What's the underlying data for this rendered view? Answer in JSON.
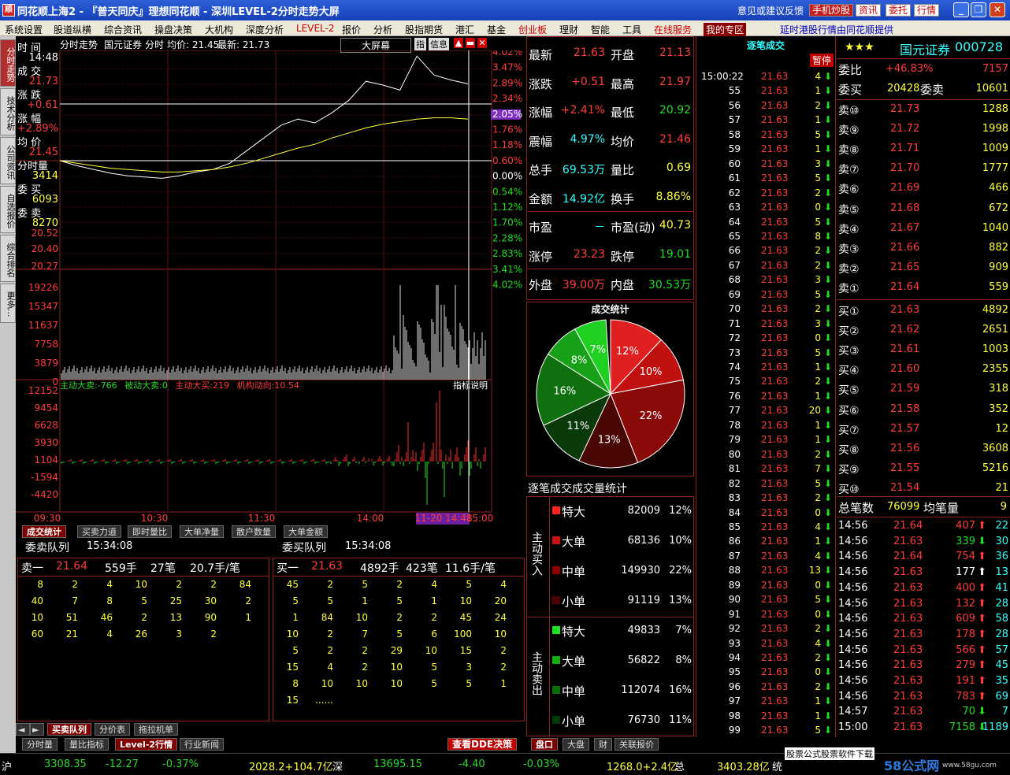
{
  "title": "同花顺上海2 - 『普天同庆』理想同花顺 - 深圳LEVEL-2分时走势大屏",
  "titlebar": {
    "feedback": "意见或建议反馈",
    "mobile": "手机炒股",
    "info": "资讯",
    "commission": "委托",
    "quote": "行情"
  },
  "menu": [
    "系统设置",
    "股道纵横",
    "综合资讯",
    "操盘决策",
    "大机构",
    "深度分析",
    "LEVEL-2",
    "报价",
    "分析",
    "股指期货",
    "港汇",
    "基金",
    "创业板",
    "理财",
    "智能",
    "工具",
    "在线服务",
    "我的专区",
    "延时港股行情由同花顺提供"
  ],
  "sidebar": [
    "分时走势",
    "技术分析",
    "公司资讯",
    "自选报价",
    "综合排名",
    "更多..."
  ],
  "left_info": {
    "time_lbl": "时 间",
    "time_val": "14:48",
    "trade_lbl": "成 交",
    "trade_val": "21.73",
    "chg_lbl": "涨 跌",
    "chg_val": "+0.61",
    "pct_lbl": "涨 幅",
    "pct_val": "+2.89%",
    "avg_lbl": "均 价",
    "avg_val": "21.45",
    "vol_lbl": "分时量",
    "vol_val": "3414",
    "bid_lbl": "委 买",
    "bid_val": "6093",
    "ask_lbl": "委 卖",
    "ask_val": "8270"
  },
  "chart_header": {
    "title": "分时走势",
    "broker": "国元证券",
    "mode": "分时",
    "avg": "均价: 21.45",
    "last": "最新: 21.73",
    "bigscreen": "大屏幕",
    "btn_fit": "指",
    "btn_info": "信息"
  },
  "chart_data": {
    "type": "line",
    "price_axis_left": [
      "20.52",
      "20.40",
      "20.27"
    ],
    "pct_axis_right": [
      "4.02%",
      "3.47%",
      "2.89%",
      "2.34%",
      "2.05%",
      "1.76%",
      "1.18%",
      "0.60%",
      "0.00%",
      "0.54%",
      "1.12%",
      "1.70%",
      "2.28%",
      "2.83%",
      "3.41%",
      "4.02%"
    ],
    "volume_axis": [
      "19226",
      "15347",
      "11637",
      "7758",
      "3879",
      "0"
    ],
    "flow_axis": [
      "12152",
      "9454",
      "6628",
      "3930",
      "1104",
      "-1594",
      "-4420"
    ],
    "time_axis": [
      "09:30",
      "10:30",
      "11:30",
      "14:00",
      "11-20 14:48",
      "15:00"
    ],
    "price": [
      21.12,
      21.08,
      21.05,
      21.02,
      21.0,
      20.99,
      20.98,
      21.0,
      21.03,
      21.05,
      21.1,
      21.2,
      21.3,
      21.4,
      21.45,
      21.42,
      21.5,
      21.6,
      21.75,
      21.72,
      21.68,
      21.95,
      21.8,
      21.76,
      21.73
    ],
    "avg_line": [
      21.12,
      21.1,
      21.08,
      21.06,
      21.05,
      21.04,
      21.03,
      21.03,
      21.04,
      21.05,
      21.07,
      21.1,
      21.14,
      21.18,
      21.22,
      21.25,
      21.3,
      21.34,
      21.38,
      21.41,
      21.43,
      21.45,
      21.46,
      21.46,
      21.45
    ]
  },
  "flow_legend": {
    "a": "主动大卖:",
    "a_val": "-766",
    "b": "被动大卖:",
    "b_val": "0",
    "c": "主动大买:",
    "c_val": "219",
    "d": "机构动向:",
    "d_val": "10.54",
    "explain": "指标说明"
  },
  "tabs_mid": [
    "成交统计",
    "买卖力道",
    "即时量比",
    "大单净量",
    "散户数量",
    "大单金额"
  ],
  "queue": {
    "sell_title": "委卖队列",
    "sell_time": "15:34:08",
    "buy_title": "委买队列",
    "buy_time": "15:34:08",
    "sell_head": [
      "卖一",
      "21.64",
      "559手",
      "27笔",
      "20.7手/笔"
    ],
    "buy_head": [
      "买一",
      "21.63",
      "4892手",
      "423笔",
      "11.6手/笔"
    ],
    "sell_rows": [
      [
        "8",
        "2",
        "4",
        "10",
        "2",
        "2",
        "84"
      ],
      [
        "40",
        "7",
        "8",
        "5",
        "25",
        "30",
        "2"
      ],
      [
        "10",
        "51",
        "46",
        "2",
        "13",
        "90",
        "1"
      ],
      [
        "60",
        "21",
        "4",
        "26",
        "3",
        "2",
        ""
      ]
    ],
    "buy_rows": [
      [
        "45",
        "2",
        "5",
        "2",
        "4",
        "5",
        "4"
      ],
      [
        "5",
        "5",
        "1",
        "5",
        "1",
        "10",
        "20"
      ],
      [
        "1",
        "84",
        "10",
        "2",
        "2",
        "45",
        "24"
      ],
      [
        "10",
        "2",
        "7",
        "5",
        "6",
        "100",
        "10"
      ],
      [
        "5",
        "2",
        "2",
        "29",
        "10",
        "15",
        "2"
      ],
      [
        "15",
        "4",
        "2",
        "10",
        "5",
        "3",
        "2"
      ],
      [
        "8",
        "10",
        "10",
        "10",
        "5",
        "5",
        "1"
      ],
      [
        "15",
        "......",
        "",
        "",
        "",
        "",
        ""
      ]
    ]
  },
  "bottom_tabs1": [
    "买卖队列",
    "分价表",
    "拖拉机单"
  ],
  "bottom_tabs2": [
    "分时量",
    "量比指标",
    "Level-2行情",
    "行业新闻"
  ],
  "ddebtn": "查看DDE决策",
  "bottom_tabs3": [
    "盘口",
    "大盘",
    "财",
    "关联报价"
  ],
  "quote": [
    {
      "l": "最新",
      "v": "21.63",
      "l2": "开盘",
      "v2": "21.13"
    },
    {
      "l": "涨跌",
      "v": "+0.51",
      "l2": "最高",
      "v2": "21.97"
    },
    {
      "l": "涨幅",
      "v": "+2.41%",
      "l2": "最低",
      "v2": "20.92"
    },
    {
      "l": "震幅",
      "v": "4.97%",
      "l2": "均价",
      "v2": "21.46"
    },
    {
      "l": "总手",
      "v": "69.53万",
      "l2": "量比",
      "v2": "0.69"
    },
    {
      "l": "金额",
      "v": "14.92亿",
      "l2": "换手",
      "v2": "8.86%"
    },
    {
      "l": "市盈",
      "v": "－",
      "l2": "市盈(动)",
      "v2": "40.73"
    },
    {
      "l": "涨停",
      "v": "23.23",
      "l2": "跌停",
      "v2": "19.01"
    },
    {
      "l": "外盘",
      "v": "39.00万",
      "l2": "内盘",
      "v2": "30.53万"
    }
  ],
  "pie": {
    "title": "成交统计",
    "slices": [
      {
        "pct": 12,
        "color": "#e02020"
      },
      {
        "pct": 10,
        "color": "#c01010"
      },
      {
        "pct": 22,
        "color": "#8a0a0a"
      },
      {
        "pct": 13,
        "color": "#4a0505"
      },
      {
        "pct": 11,
        "color": "#0a3a0a"
      },
      {
        "pct": 16,
        "color": "#107010"
      },
      {
        "pct": 8,
        "color": "#18a018"
      },
      {
        "pct": 7,
        "color": "#20d020"
      }
    ]
  },
  "vol_stats": {
    "title": "逐笔成交成交量统计",
    "buy_lbl": "主动买入",
    "sell_lbl": "主动卖出",
    "buy": [
      {
        "n": "特大",
        "v": "82009",
        "p": "12%"
      },
      {
        "n": "大单",
        "v": "68136",
        "p": "10%"
      },
      {
        "n": "中单",
        "v": "149930",
        "p": "22%"
      },
      {
        "n": "小单",
        "v": "91119",
        "p": "13%"
      }
    ],
    "sell": [
      {
        "n": "特大",
        "v": "49833",
        "p": "7%"
      },
      {
        "n": "大单",
        "v": "56822",
        "p": "8%"
      },
      {
        "n": "中单",
        "v": "112074",
        "p": "16%"
      },
      {
        "n": "小单",
        "v": "76730",
        "p": "11%"
      }
    ]
  },
  "ticks": {
    "title": "逐笔成交",
    "pause": "暂停",
    "first_time": "15:00:22",
    "rows": [
      [
        "",
        21.63,
        4
      ],
      [
        "55",
        21.63,
        1
      ],
      [
        "56",
        21.63,
        2
      ],
      [
        "57",
        21.63,
        1
      ],
      [
        "58",
        21.63,
        5
      ],
      [
        "59",
        21.63,
        1
      ],
      [
        "60",
        21.63,
        3
      ],
      [
        "61",
        21.63,
        5
      ],
      [
        "62",
        21.63,
        2
      ],
      [
        "63",
        21.63,
        0
      ],
      [
        "64",
        21.63,
        5
      ],
      [
        "65",
        21.63,
        8
      ],
      [
        "66",
        21.63,
        2
      ],
      [
        "67",
        21.63,
        2
      ],
      [
        "68",
        21.63,
        3
      ],
      [
        "69",
        21.63,
        5
      ],
      [
        "70",
        21.63,
        2
      ],
      [
        "71",
        21.63,
        3
      ],
      [
        "72",
        21.63,
        0
      ],
      [
        "73",
        21.63,
        5
      ],
      [
        "74",
        21.63,
        1
      ],
      [
        "75",
        21.63,
        2
      ],
      [
        "76",
        21.63,
        1
      ],
      [
        "77",
        21.63,
        20
      ],
      [
        "78",
        21.63,
        1
      ],
      [
        "79",
        21.63,
        1
      ],
      [
        "80",
        21.63,
        2
      ],
      [
        "81",
        21.63,
        7
      ],
      [
        "82",
        21.63,
        5
      ],
      [
        "83",
        21.63,
        2
      ],
      [
        "84",
        21.63,
        0
      ],
      [
        "85",
        21.63,
        4
      ],
      [
        "86",
        21.63,
        1
      ],
      [
        "87",
        21.63,
        4
      ],
      [
        "88",
        21.63,
        13
      ],
      [
        "89",
        21.63,
        0
      ],
      [
        "90",
        21.63,
        5
      ],
      [
        "91",
        21.63,
        0
      ],
      [
        "92",
        21.63,
        2
      ],
      [
        "93",
        21.63,
        4
      ],
      [
        "94",
        21.63,
        2
      ],
      [
        "95",
        21.63,
        0
      ],
      [
        "96",
        21.63,
        2
      ],
      [
        "97",
        21.63,
        1
      ],
      [
        "98",
        21.63,
        1
      ],
      [
        "99",
        21.63,
        5
      ]
    ]
  },
  "stock": {
    "stars": "★★★",
    "name": "国元证券",
    "code": "000728",
    "wb_lbl": "委比",
    "wb": "+46.83%",
    "wc": "7157",
    "wm_lbl": "委买",
    "wm": "20428",
    "ws_lbl": "委卖",
    "ws": "10601"
  },
  "orderbook": {
    "sells": [
      [
        "卖⑩",
        "21.73",
        "1288"
      ],
      [
        "卖⑨",
        "21.72",
        "1998"
      ],
      [
        "卖⑧",
        "21.71",
        "1009"
      ],
      [
        "卖⑦",
        "21.70",
        "1777"
      ],
      [
        "卖⑥",
        "21.69",
        "466"
      ],
      [
        "卖⑤",
        "21.68",
        "672"
      ],
      [
        "卖④",
        "21.67",
        "1040"
      ],
      [
        "卖③",
        "21.66",
        "882"
      ],
      [
        "卖②",
        "21.65",
        "909"
      ],
      [
        "卖①",
        "21.64",
        "559"
      ]
    ],
    "buys": [
      [
        "买①",
        "21.63",
        "4892"
      ],
      [
        "买②",
        "21.62",
        "2651"
      ],
      [
        "买③",
        "21.61",
        "1003"
      ],
      [
        "买④",
        "21.60",
        "2355"
      ],
      [
        "买⑤",
        "21.59",
        "318"
      ],
      [
        "买⑥",
        "21.58",
        "352"
      ],
      [
        "买⑦",
        "21.57",
        "12"
      ],
      [
        "买⑧",
        "21.56",
        "3608"
      ],
      [
        "买⑨",
        "21.55",
        "5216"
      ],
      [
        "买⑩",
        "21.54",
        "21"
      ]
    ],
    "total_lbl": "总笔数",
    "total": "76099",
    "avg_lbl": "均笔量",
    "avg": "9"
  },
  "recent": [
    [
      "14:56",
      "21.64",
      "407",
      "up",
      "22"
    ],
    [
      "14:56",
      "21.63",
      "339",
      "dn",
      "30"
    ],
    [
      "14:56",
      "21.64",
      "754",
      "up",
      "36"
    ],
    [
      "14:56",
      "21.63",
      "177",
      "wup",
      "13"
    ],
    [
      "14:56",
      "21.63",
      "400",
      "up",
      "41"
    ],
    [
      "14:56",
      "21.63",
      "132",
      "up",
      "28"
    ],
    [
      "14:56",
      "21.63",
      "609",
      "up",
      "58"
    ],
    [
      "14:56",
      "21.63",
      "178",
      "up",
      "28"
    ],
    [
      "14:56",
      "21.63",
      "566",
      "up",
      "57"
    ],
    [
      "14:56",
      "21.63",
      "279",
      "up",
      "45"
    ],
    [
      "14:56",
      "21.63",
      "191",
      "up",
      "35"
    ],
    [
      "14:56",
      "21.63",
      "783",
      "up",
      "69"
    ],
    [
      "14:57",
      "21.63",
      "70",
      "dn",
      "7"
    ],
    [
      "15:00",
      "21.63",
      "7158",
      "dn",
      "1189"
    ]
  ],
  "status": {
    "sh": "沪",
    "sh_idx": "3308.35",
    "sh_chg": "-12.27",
    "sh_pct": "-0.37%",
    "sh_amt": "2028.2+104.7亿",
    "sz": "深",
    "sz_idx": "13695.15",
    "sz_chg": "-4.40",
    "sz_pct": "-0.03%",
    "sz_amt": "1268.0+2.4亿",
    "tot": "总",
    "tot_amt": "3403.28亿",
    "sys": "统",
    "ad": "股票公式股票软件下载",
    "brand": "58公式网",
    "site": "www.58gu.com"
  }
}
